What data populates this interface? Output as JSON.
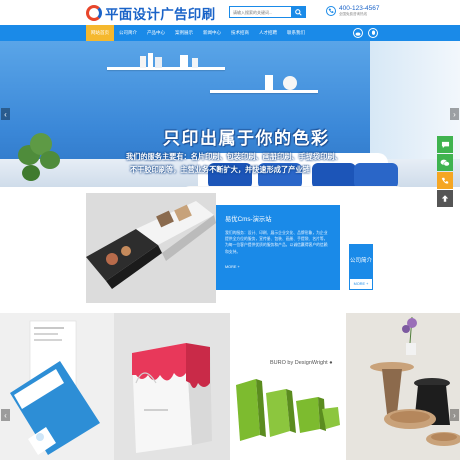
{
  "header": {
    "logo_text": "平面设计广告印刷",
    "search_placeholder": "请输入搜索的关键词...",
    "phone_number": "400-123-4567",
    "phone_subtitle": "全国免费咨询热线"
  },
  "nav": {
    "items": [
      {
        "label": "网站首页",
        "active": true
      },
      {
        "label": "公司简介",
        "active": false
      },
      {
        "label": "产品中心",
        "active": false
      },
      {
        "label": "案例展示",
        "active": false
      },
      {
        "label": "新闻中心",
        "active": false
      },
      {
        "label": "技术招商",
        "active": false
      },
      {
        "label": "人才招聘",
        "active": false
      },
      {
        "label": "联系我们",
        "active": false
      }
    ],
    "social_icons": [
      "weibo-icon",
      "qq-icon"
    ]
  },
  "banner": {
    "headline": "只印出属于你的色彩",
    "line1": "我们的服务主要有：名片印刷、包装印刷、画册印刷、手提袋印刷、",
    "line2": "不干胶印刷等，主营业务不断扩大，并快速形成了产业链"
  },
  "float_toolbar": {
    "items": [
      "chat-icon",
      "wechat-icon",
      "phone-icon",
      "back-to-top-icon"
    ],
    "colors": [
      "#3fb34f",
      "#3fb34f",
      "#f5a623",
      "#555555"
    ]
  },
  "about": {
    "title": "易优Cms-演示站",
    "text": "我们的服务：设计、印刷、展示企业文化、品牌形象，为企业提供全方位的服务，宣传册、包装、画册、手提袋、名片等，为每一位客户提供优质的服务和产品，以诚信赢得客户的信赖和支持。",
    "more": "MORE +",
    "tag_label": "公司简介",
    "tag_more": "MORE +"
  },
  "gallery": {
    "caption": "BURO by DesignWright ●"
  },
  "colors": {
    "brand_blue": "#1a8ae8",
    "logo_blue": "#1a63c8",
    "active_nav": "#f5b82e"
  }
}
